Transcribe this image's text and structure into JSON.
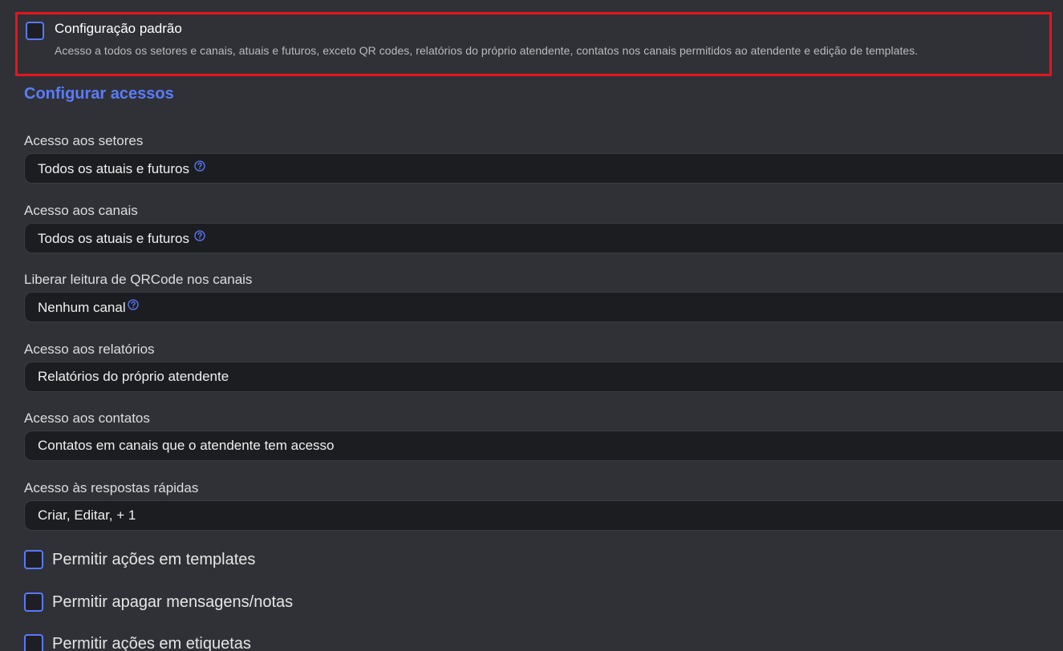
{
  "default_config": {
    "title": "Configuração padrão",
    "description": "Acesso a todos os setores e canais, atuais e futuros, exceto QR codes, relatórios do próprio atendente, contatos nos canais permitidos ao atendente e edição de templates.",
    "checked": false
  },
  "section": {
    "title": "Configurar acessos"
  },
  "fields": [
    {
      "label": "Acesso aos setores",
      "value": "Todos os atuais e futuros",
      "help": true
    },
    {
      "label": "Acesso aos canais",
      "value": "Todos os atuais e futuros",
      "help": true
    },
    {
      "label": "Liberar leitura de QRCode nos canais",
      "value": "Nenhum canal",
      "help": true
    },
    {
      "label": "Acesso aos relatórios",
      "value": "Relatórios do próprio atendente",
      "help": false
    },
    {
      "label": "Acesso aos contatos",
      "value": "Contatos em canais que o atendente tem acesso",
      "help": false
    },
    {
      "label": "Acesso às respostas rápidas",
      "value": "Criar, Editar, + 1",
      "help": false
    }
  ],
  "permissions": [
    {
      "label": "Permitir ações em templates",
      "checked": false
    },
    {
      "label": "Permitir apagar mensagens/notas",
      "checked": false
    },
    {
      "label": "Permitir ações em etiquetas",
      "checked": false
    }
  ],
  "colors": {
    "accent": "#5b7cff",
    "highlight_border": "#e3161d",
    "background": "#2f3136",
    "field_background": "#1c1d21"
  },
  "icons": {
    "help": "help-circle-icon"
  }
}
